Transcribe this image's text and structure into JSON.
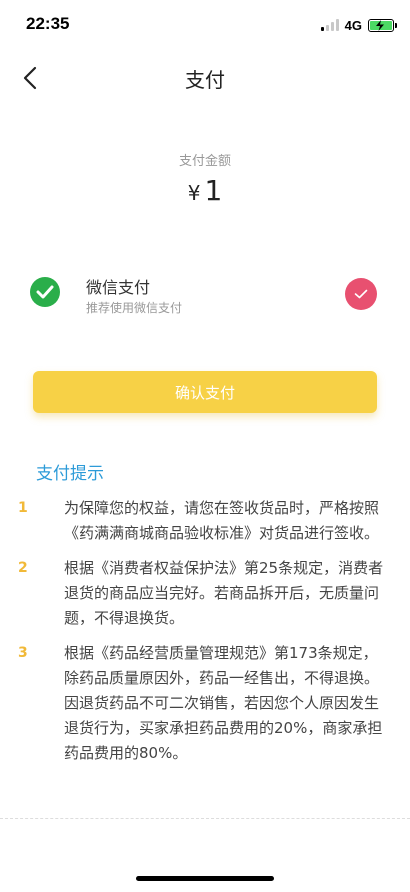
{
  "status": {
    "time": "22:35",
    "network": "4G"
  },
  "nav": {
    "title": "支付",
    "back_icon": "chevron-left-icon"
  },
  "amount": {
    "label": "支付金额",
    "currency": "¥",
    "value": "1"
  },
  "payment": {
    "name": "微信支付",
    "subtitle": "推荐使用微信支付",
    "icon": "wechat-icon",
    "selected": true,
    "check_color": "#e85070"
  },
  "confirm": {
    "label": "确认支付",
    "color": "#f7d146"
  },
  "tips": {
    "title": "支付提示",
    "items": [
      {
        "num": "1",
        "text": "为保障您的权益，请您在签收货品时，严格按照《药满满商城商品验收标准》对货品进行签收。"
      },
      {
        "num": "2",
        "text": "根据《消费者权益保护法》第25条规定，消费者退货的商品应当完好。若商品拆开后，无质量问题，不得退换货。"
      },
      {
        "num": "3",
        "text": "根据《药品经营质量管理规范》第173条规定，除药品质量原因外，药品一经售出，不得退换。因退货药品不可二次销售，若因您个人原因发生退货行为，买家承担药品费用的20%，商家承担药品费用的80%。"
      }
    ]
  },
  "colors": {
    "accent_blue": "#2d9bd8",
    "tip_number": "#f1b938",
    "wechat_green": "#2aae4a"
  }
}
